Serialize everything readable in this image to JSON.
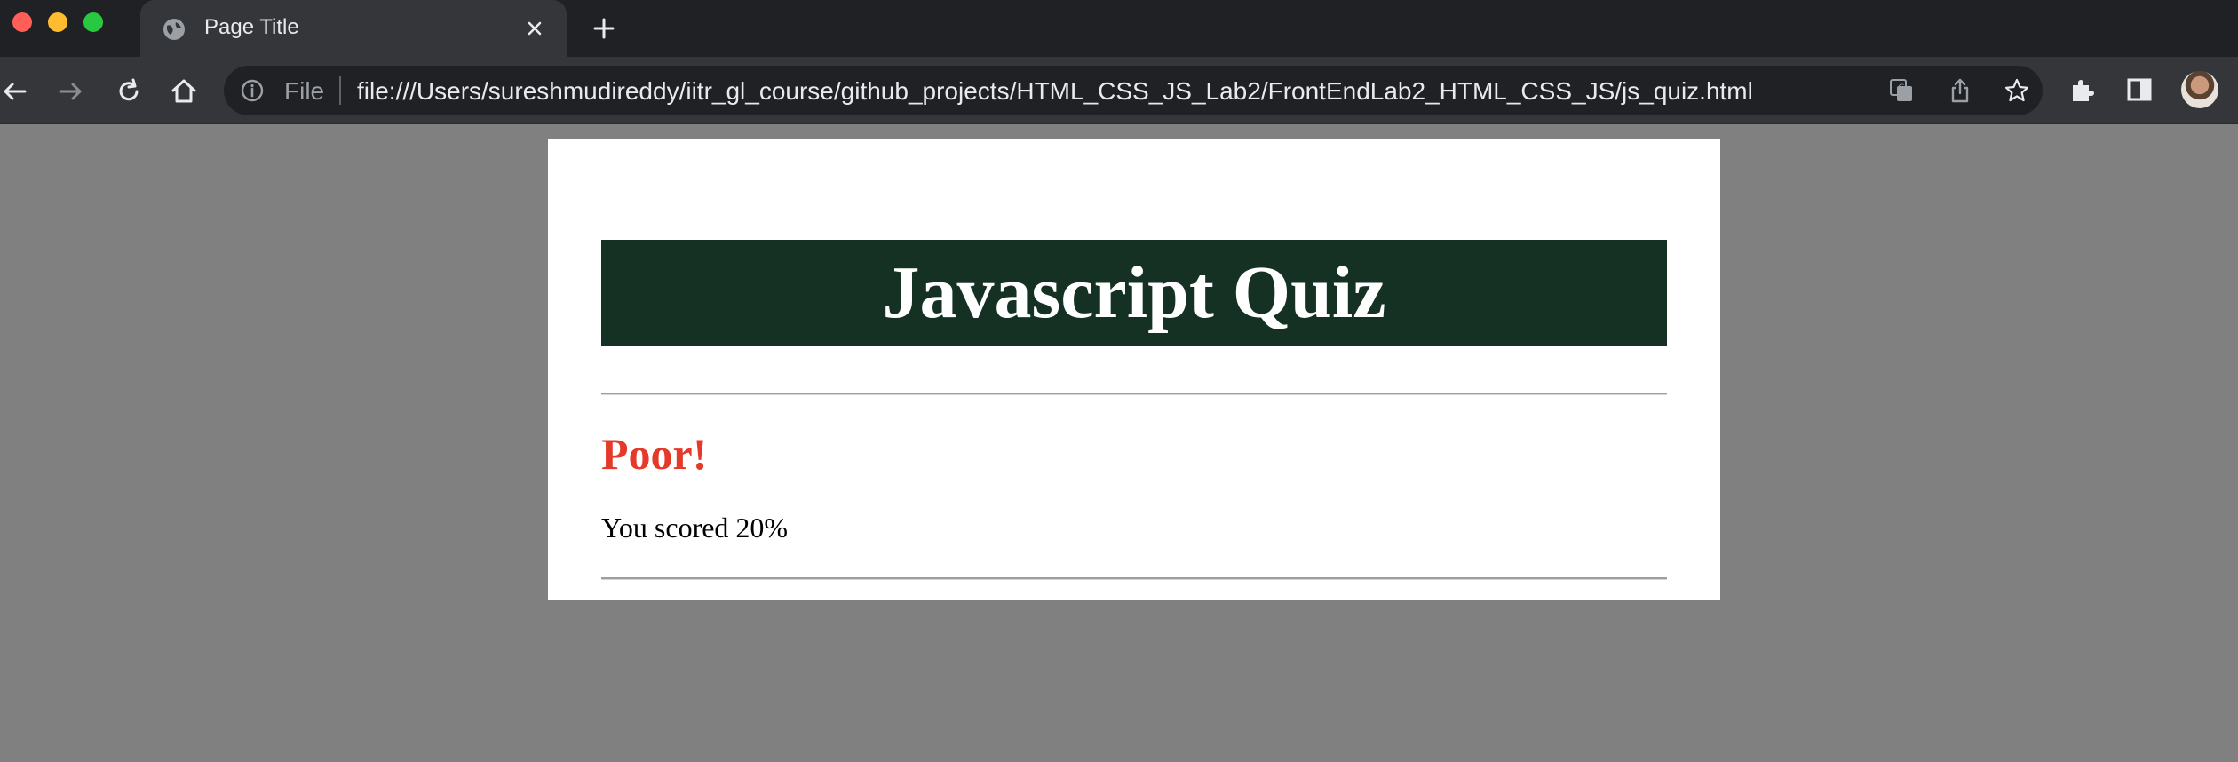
{
  "browser": {
    "tab": {
      "title": "Page Title",
      "favicon": "globe-icon"
    },
    "toolbar": {
      "back": "back-arrow-icon",
      "forward": "forward-arrow-icon",
      "reload": "reload-icon",
      "home": "home-icon"
    },
    "omnibox": {
      "scheme_label": "File",
      "url": "file:///Users/sureshmudireddy/iitr_gl_course/github_projects/HTML_CSS_JS_Lab2/FrontEndLab2_HTML_CSS_JS/js_quiz.html"
    },
    "right_icons": [
      "translate-icon",
      "share-icon",
      "bookmark-star-icon",
      "extensions-icon",
      "side-panel-icon",
      "avatar"
    ]
  },
  "page": {
    "banner_title": "Javascript Quiz",
    "result_heading": "Poor!",
    "score_text": "You scored 20%"
  },
  "colors": {
    "banner_background": "#143124",
    "banner_text": "#ffffff",
    "result_heading": "#e53a2a",
    "page_background": "#808080",
    "card_background": "#ffffff"
  }
}
